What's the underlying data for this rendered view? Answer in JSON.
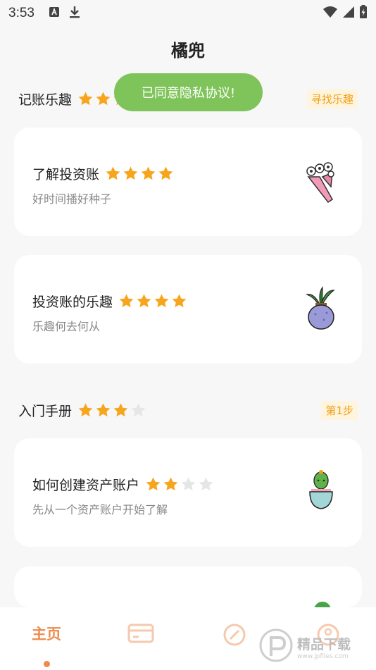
{
  "status": {
    "time": "3:53"
  },
  "app": {
    "title": "橘兜"
  },
  "toast": {
    "text": "已同意隐私协议!"
  },
  "sections": [
    {
      "title": "记账乐趣",
      "rating": 3,
      "max_rating": 4,
      "tag": "寻找乐趣",
      "cards": [
        {
          "title": "了解投资账",
          "subtitle": "好时间播好种子",
          "rating": 4,
          "max_rating": 4,
          "art": "bouquet-icon"
        },
        {
          "title": "投资账的乐趣",
          "subtitle": "乐趣何去何从",
          "rating": 4,
          "max_rating": 4,
          "art": "potted-plant-icon"
        }
      ]
    },
    {
      "title": "入门手册",
      "rating": 3,
      "max_rating": 4,
      "tag": "第1步",
      "cards": [
        {
          "title": "如何创建资产账户",
          "subtitle": "先从一个资产账户开始了解",
          "rating": 2,
          "max_rating": 4,
          "art": "cactus-pot-icon"
        }
      ]
    }
  ],
  "tabs": [
    {
      "label": "主页",
      "icon": "home-text",
      "active": true
    },
    {
      "label": "",
      "icon": "card-icon",
      "active": false
    },
    {
      "label": "",
      "icon": "compass-icon",
      "active": false
    },
    {
      "label": "",
      "icon": "profile-icon",
      "active": false
    }
  ],
  "watermark": {
    "text": "精品下载",
    "url": "www.jpfiles.com"
  },
  "colors": {
    "accent": "#f08a4b",
    "star_on": "#f7a51c",
    "star_off": "#e6e6e6",
    "toast_bg": "#7fc45a",
    "tag_bg": "#fff4dd",
    "tag_text": "#f2a01b"
  }
}
